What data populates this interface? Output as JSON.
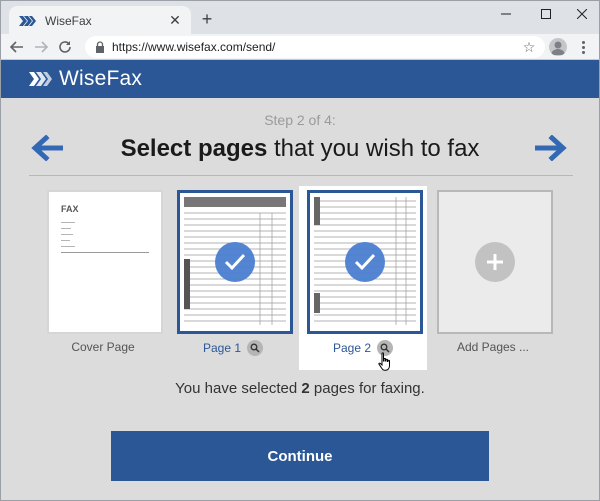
{
  "browser": {
    "tab_title": "WiseFax",
    "new_tab_label": "+",
    "url": "https://www.wisefax.com/send/"
  },
  "app": {
    "logo_text": "WiseFax",
    "brand_color": "#2b5797"
  },
  "wizard": {
    "step_text": "Step 2 of 4:",
    "title_bold": "Select pages",
    "title_rest": " that you wish to fax"
  },
  "pages": [
    {
      "label": "Cover Page",
      "selected": false,
      "cover_heading": "FAX"
    },
    {
      "label": "Page 1",
      "selected": true
    },
    {
      "label": "Page 2",
      "selected": true
    },
    {
      "label": "Add Pages ...",
      "selected": false
    }
  ],
  "summary": {
    "prefix": "You have selected ",
    "count": "2",
    "suffix": " pages for faxing."
  },
  "continue_label": "Continue"
}
